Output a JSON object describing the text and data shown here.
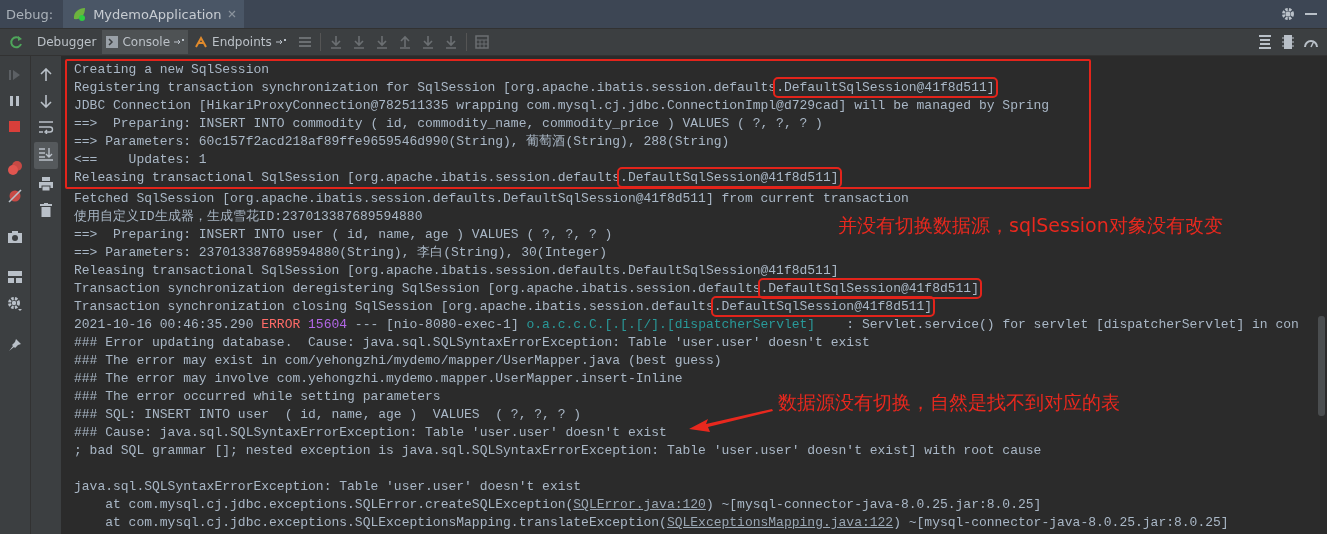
{
  "header": {
    "label": "Debug:",
    "tab": {
      "title": "MydemoApplication"
    }
  },
  "toolbar": {
    "tabs": [
      {
        "label": "Debugger",
        "selected": false
      },
      {
        "label": "Console",
        "selected": true
      },
      {
        "label": "Endpoints",
        "selected": false
      }
    ]
  },
  "side_tools": {
    "scroll_to_end": true
  },
  "console": {
    "boxed_lines": [
      {
        "segments": [
          {
            "text": "Creating a new SqlSession",
            "kind": "plain"
          }
        ]
      },
      {
        "segments": [
          {
            "text": "Registering transaction synchronization for SqlSession [org.apache.ibatis.session.defaults",
            "kind": "plain"
          },
          {
            "text": ".DefaultSqlSession@41f8d511]",
            "kind": "boxed"
          }
        ]
      },
      {
        "segments": [
          {
            "text": "JDBC Connection [HikariProxyConnection@782511335 wrapping com.mysql.cj.jdbc.ConnectionImpl@d729cad] will be managed by Spring",
            "kind": "plain"
          }
        ]
      },
      {
        "segments": [
          {
            "text": "==>  Preparing: INSERT INTO commodity ( id, commodity_name, commodity_price ) VALUES ( ?, ?, ? )",
            "kind": "plain"
          }
        ]
      },
      {
        "segments": [
          {
            "text": "==> Parameters: 60c157f2acd218af89ffe9659546d990(String), 葡萄酒(String), 288(String)",
            "kind": "plain"
          }
        ]
      },
      {
        "segments": [
          {
            "text": "<==    Updates: 1",
            "kind": "plain"
          }
        ]
      },
      {
        "segments": [
          {
            "text": "Releasing transactional SqlSession [org.apache.ibatis.session.defaults",
            "kind": "plain"
          },
          {
            "text": ".DefaultSqlSession@41f8d511]",
            "kind": "boxed"
          }
        ]
      }
    ],
    "lines": [
      {
        "segments": [
          {
            "text": "Fetched SqlSession [org.apache.ibatis.session.defaults.DefaultSqlSession@41f8d511] from current transaction",
            "kind": "plain"
          }
        ]
      },
      {
        "segments": [
          {
            "text": "使用自定义ID生成器，生成雪花ID:237013387689594880",
            "kind": "plain"
          }
        ]
      },
      {
        "segments": [
          {
            "text": "==>  Preparing: INSERT INTO user ( id, name, age ) VALUES ( ?, ?, ? )",
            "kind": "plain"
          }
        ]
      },
      {
        "segments": [
          {
            "text": "==> Parameters: 237013387689594880(String), 李白(String), 30(Integer)",
            "kind": "plain"
          }
        ]
      },
      {
        "segments": [
          {
            "text": "Releasing transactional SqlSession [org.apache.ibatis.session.defaults.DefaultSqlSession@41f8d511]",
            "kind": "plain"
          }
        ]
      },
      {
        "segments": [
          {
            "text": "Transaction synchronization deregistering SqlSession [org.apache.ibatis.session.defaults",
            "kind": "plain"
          },
          {
            "text": ".DefaultSqlSession@41f8d511]",
            "kind": "boxed"
          }
        ]
      },
      {
        "segments": [
          {
            "text": "Transaction synchronization closing SqlSession [org.apache.ibatis.session.defaults",
            "kind": "plain"
          },
          {
            "text": ".DefaultSqlSession@41f8d511]",
            "kind": "boxed"
          }
        ]
      },
      {
        "segments": [
          {
            "text": "2021-10-16 00:46:35.290 ",
            "kind": "plain"
          },
          {
            "text": "ERROR ",
            "kind": "error"
          },
          {
            "text": "15604",
            "kind": "pid"
          },
          {
            "text": " --- [nio-8080-exec-1] ",
            "kind": "plain"
          },
          {
            "text": "o.a.c.c.C.[.[.[/].[dispatcherServlet]",
            "kind": "logger"
          },
          {
            "text": "    : Servlet.service() for servlet [dispatcherServlet] in con",
            "kind": "plain"
          }
        ]
      },
      {
        "segments": [
          {
            "text": "### Error updating database.  Cause: java.sql.SQLSyntaxErrorException: Table 'user.user' doesn't exist",
            "kind": "plain"
          }
        ]
      },
      {
        "segments": [
          {
            "text": "### The error may exist in com/yehongzhi/mydemo/mapper/UserMapper.java (best guess)",
            "kind": "plain"
          }
        ]
      },
      {
        "segments": [
          {
            "text": "### The error may involve com.yehongzhi.mydemo.mapper.UserMapper.insert-Inline",
            "kind": "plain"
          }
        ]
      },
      {
        "segments": [
          {
            "text": "### The error occurred while setting parameters",
            "kind": "plain"
          }
        ]
      },
      {
        "segments": [
          {
            "text": "### SQL: INSERT INTO user  ( id, name, age )  VALUES  ( ?, ?, ? )",
            "kind": "plain"
          }
        ]
      },
      {
        "segments": [
          {
            "text": "### Cause: java.sql.SQLSyntaxErrorException: Table 'user.user' doesn't exist",
            "kind": "plain"
          }
        ]
      },
      {
        "segments": [
          {
            "text": "; bad SQL grammar []; nested exception is java.sql.SQLSyntaxErrorException: Table 'user.user' doesn't exist] with root cause",
            "kind": "plain"
          }
        ]
      },
      {
        "gap_before": true,
        "segments": [
          {
            "text": "java.sql.SQLSyntaxErrorException: Table 'user.user' doesn't exist",
            "kind": "plain"
          }
        ]
      },
      {
        "segments": [
          {
            "text": "    at com.mysql.cj.jdbc.exceptions.SQLError.createSQLException(",
            "kind": "plain"
          },
          {
            "text": "SQLError.java:120",
            "kind": "link"
          },
          {
            "text": ") ~[mysql-connector-java-8.0.25.jar:8.0.25]",
            "kind": "plain"
          }
        ]
      },
      {
        "segments": [
          {
            "text": "    at com.mysql.cj.jdbc.exceptions.SQLExceptionsMapping.translateException(",
            "kind": "plain"
          },
          {
            "text": "SQLExceptionsMapping.java:122",
            "kind": "link"
          },
          {
            "text": ") ~[mysql-connector-java-8.0.25.jar:8.0.25]",
            "kind": "plain"
          }
        ]
      }
    ]
  },
  "annotations": [
    {
      "text": "并没有切换数据源，sqlSession对象没有改变",
      "kind": "note"
    },
    {
      "text": "数据源没有切换，自然是找不到对应的表",
      "kind": "arrow_note"
    }
  ]
}
